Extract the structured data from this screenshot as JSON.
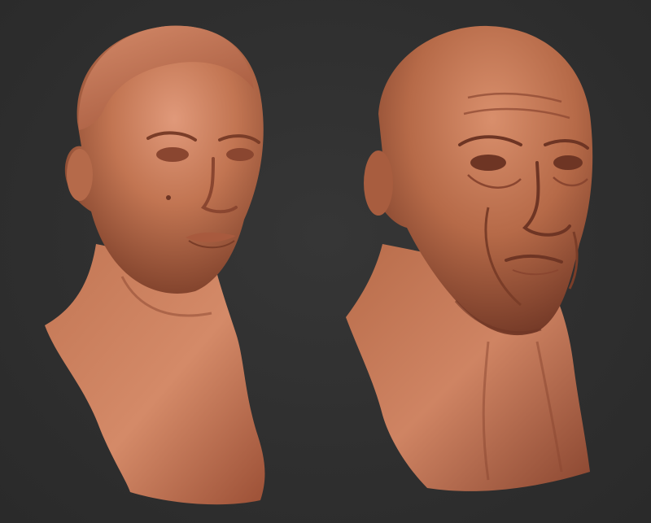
{
  "scene": {
    "background_color": "#2f2f2f",
    "material_color": "#b8694a",
    "material_highlight": "#e39a78",
    "material_shadow": "#6e3524"
  },
  "models": [
    {
      "id": "female-bust",
      "icon": "sculpted-female-head-icon"
    },
    {
      "id": "male-bust",
      "icon": "sculpted-male-head-icon"
    }
  ]
}
